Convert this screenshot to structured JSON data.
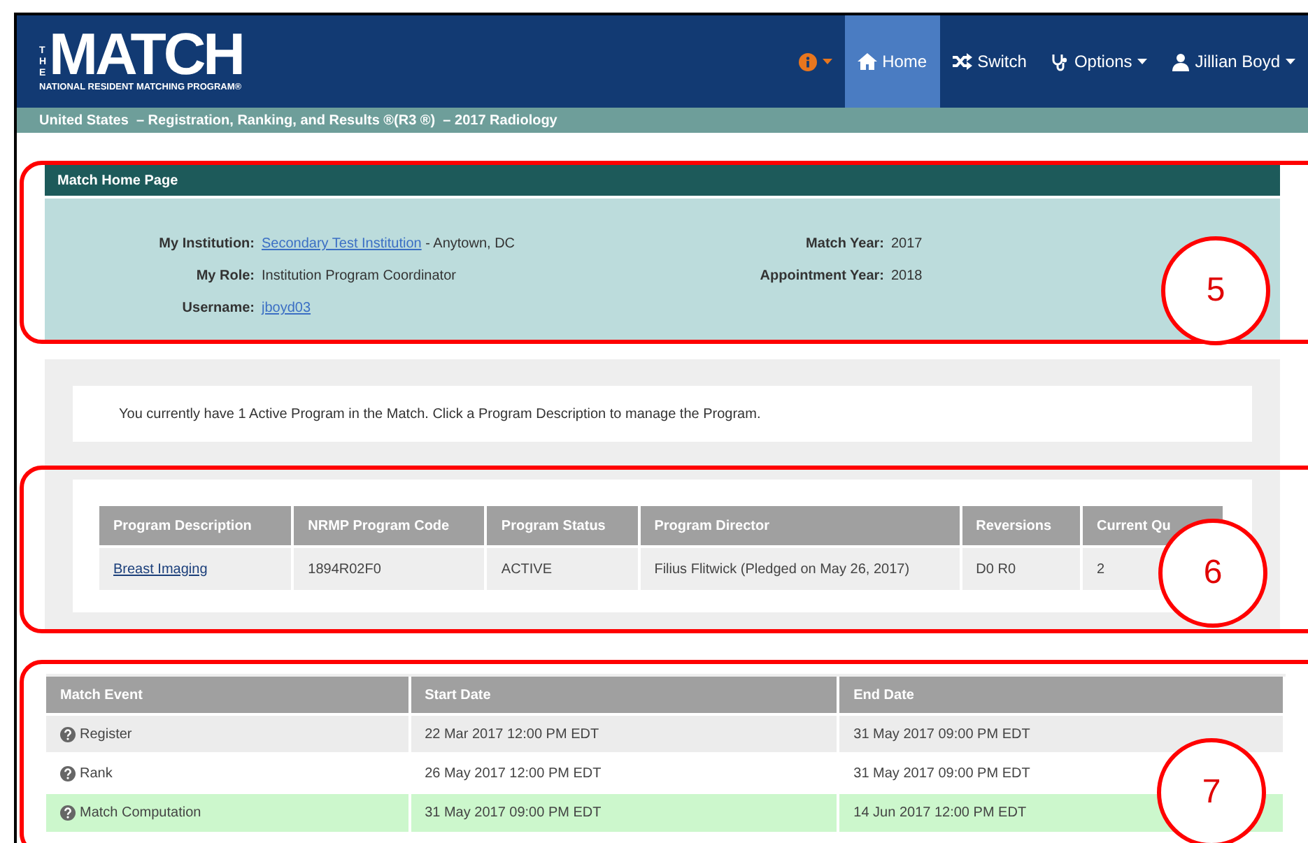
{
  "header": {
    "logo": {
      "the": "THE",
      "match": "MATCH",
      "subtitle": "NATIONAL RESIDENT MATCHING PROGRAM®"
    },
    "nav": [
      {
        "kind": "info",
        "selected": false
      },
      {
        "kind": "home",
        "label": "Home",
        "selected": true
      },
      {
        "kind": "switch",
        "label": "Switch",
        "selected": false
      },
      {
        "kind": "options",
        "label": "Options",
        "selected": false
      },
      {
        "kind": "user",
        "label": "Jillian Boyd",
        "selected": false
      }
    ]
  },
  "breadcrumb": "United States  – Registration, Ranking, and Results ®(R3 ®)  – 2017 Radiology",
  "home_panel": {
    "title": "Match Home Page",
    "left": [
      {
        "label": "My Institution:",
        "link": "Secondary Test Institution",
        "text": " - Anytown, DC"
      },
      {
        "label": "My Role:",
        "text": "Institution Program Coordinator"
      },
      {
        "label": "Username:",
        "link": "jboyd03"
      }
    ],
    "right": [
      {
        "label": "Match Year:",
        "text": "2017"
      },
      {
        "label": "Appointment Year:",
        "text": "2018"
      }
    ]
  },
  "message": "You currently have 1 Active Program in the Match. Click a Program Description to manage the Program.",
  "programs": {
    "columns": [
      "Program Description",
      "NRMP Program Code",
      "Program Status",
      "Program Director",
      "Reversions",
      "Current Qu"
    ],
    "rows": [
      [
        "Breast Imaging",
        "1894R02F0",
        "ACTIVE",
        "Filius Flitwick (Pledged on May 26, 2017)",
        "D0 R0",
        "2"
      ]
    ]
  },
  "events": {
    "columns": [
      "Match Event",
      "Start Date",
      "End Date"
    ],
    "rows": [
      {
        "event": "Register",
        "start": "22 Mar 2017 12:00 PM EDT",
        "end": "31 May 2017 09:00 PM EDT",
        "current": false
      },
      {
        "event": "Rank",
        "start": "26 May 2017 12:00 PM EDT",
        "end": "31 May 2017 09:00 PM EDT",
        "current": false
      },
      {
        "event": "Match Computation",
        "start": "31 May 2017 09:00 PM EDT",
        "end": "14 Jun 2017 12:00 PM EDT",
        "current": true
      }
    ]
  },
  "callouts": [
    "5",
    "6",
    "7"
  ]
}
